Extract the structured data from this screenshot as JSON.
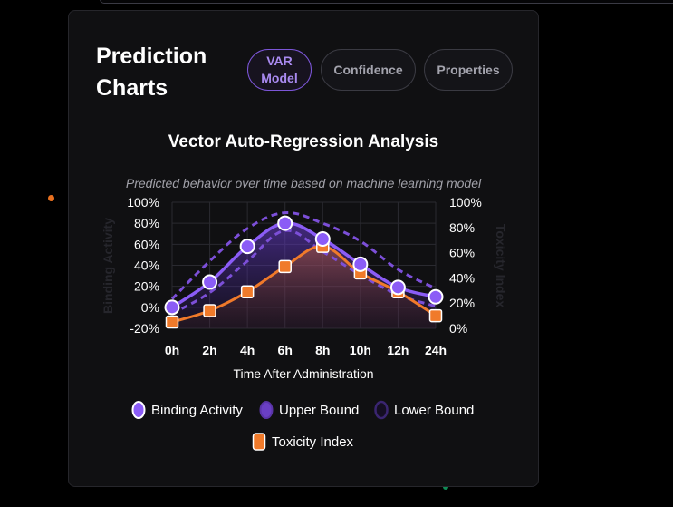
{
  "panel": {
    "title": "Prediction Charts",
    "tabs": [
      {
        "label": "VAR Model",
        "active": true
      },
      {
        "label": "Confidence",
        "active": false
      },
      {
        "label": "Properties",
        "active": false
      }
    ]
  },
  "colors": {
    "binding": "#8b5cf6",
    "bound_line": "#7c4fd8",
    "toxicity": "#f07a2a",
    "text": "#ffffff",
    "muted": "#a0a0a8"
  },
  "chart_data": {
    "type": "line",
    "title": "Vector Auto-Regression Analysis",
    "subtitle": "Predicted behavior over time based on machine learning model",
    "xlabel": "Time After Administration",
    "ylabel_left": "Binding Activity",
    "ylabel_right": "Toxicity Index",
    "categories": [
      "0h",
      "2h",
      "4h",
      "6h",
      "8h",
      "10h",
      "12h",
      "24h"
    ],
    "y_left": {
      "min": -20,
      "max": 100,
      "ticks": [
        "100%",
        "80%",
        "60%",
        "40%",
        "20%",
        "0%",
        "-20%"
      ]
    },
    "y_right": {
      "min": 0,
      "max": 100,
      "ticks": [
        "100%",
        "80%",
        "60%",
        "40%",
        "20%",
        "0%"
      ]
    },
    "grid": true,
    "legend_position": "bottom",
    "series": [
      {
        "name": "Binding Activity",
        "axis": "left",
        "style": "line",
        "values": [
          0,
          24,
          58,
          80,
          65,
          41,
          19,
          10
        ]
      },
      {
        "name": "Upper Bound",
        "axis": "left",
        "style": "dashed",
        "values": [
          8,
          44,
          75,
          90,
          80,
          63,
          36,
          18
        ]
      },
      {
        "name": "Lower Bound",
        "axis": "left",
        "style": "dashed",
        "values": [
          -6,
          14,
          44,
          73,
          53,
          31,
          12,
          1
        ]
      },
      {
        "name": "Toxicity Index",
        "axis": "right",
        "style": "line",
        "values": [
          5,
          14,
          29,
          49,
          65,
          44,
          29,
          10
        ]
      }
    ]
  }
}
